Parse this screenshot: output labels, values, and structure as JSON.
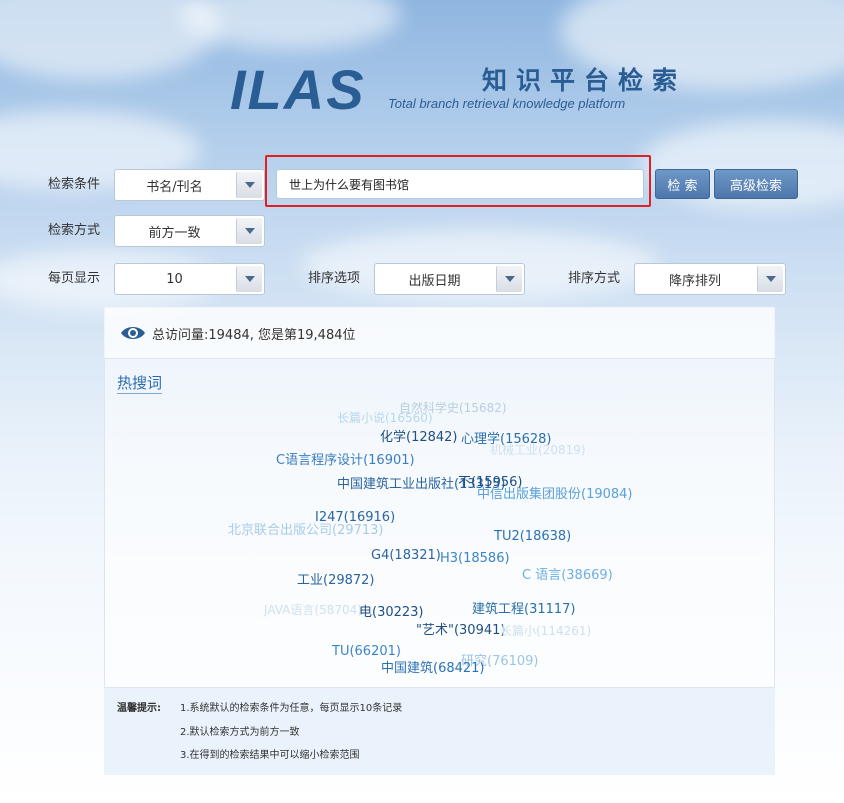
{
  "logo": {
    "brand": "ILAS",
    "title_cn": "知识平台检索",
    "title_en": "Total branch retrieval knowledge platform"
  },
  "search": {
    "condition_label": "检索条件",
    "condition_value": "书名/刊名",
    "query_value": "世上为什么要有图书馆",
    "search_button": "检 索",
    "advanced_button": "高级检索",
    "mode_label": "检索方式",
    "mode_value": "前方一致",
    "perpage_label": "每页显示",
    "perpage_value": "10",
    "sort_label": "排序选项",
    "sort_value": "出版日期",
    "order_label": "排序方式",
    "order_value": "降序排列"
  },
  "stats": {
    "visits_text": "总访问量:19484, 您是第19,484位"
  },
  "hot": {
    "title": "热搜词",
    "words": [
      {
        "text": "自然科学史(15682)",
        "color": "#b9cde3"
      },
      {
        "text": "长篇小说(16560)",
        "color": "#b5d8ec"
      },
      {
        "text": "化学(12842)",
        "color": "#1f4f82"
      },
      {
        "text": "心理学(15628)",
        "color": "#2a6fa8"
      },
      {
        "text": "机械工业(20819)",
        "color": "#cfe1ee"
      },
      {
        "text": "C语言程序设计(16901)",
        "color": "#3b7dc0"
      },
      {
        "text": "中国建筑工业出版社(13315)",
        "color": "#2c64a0"
      },
      {
        "text": "不(15956)",
        "color": "#1f4f82"
      },
      {
        "text": "中信出版集团股份(19084)",
        "color": "#5aa0d8"
      },
      {
        "text": "I247(16916)",
        "color": "#2c64a0"
      },
      {
        "text": "北京联合出版公司(29713)",
        "color": "#a9cbe6"
      },
      {
        "text": "TU2(18638)",
        "color": "#2a72b8"
      },
      {
        "text": "G4(18321)",
        "color": "#2c64a0"
      },
      {
        "text": "H3(18586)",
        "color": "#3a86c8"
      },
      {
        "text": "C 语言(38669)",
        "color": "#6fb0e0"
      },
      {
        "text": "工业(29872)",
        "color": "#2c64a0"
      },
      {
        "text": "JAVA语言(58704)",
        "color": "#cfe1ee"
      },
      {
        "text": "电(30223)",
        "color": "#1f4f82"
      },
      {
        "text": "建筑工程(31117)",
        "color": "#2a6fa8"
      },
      {
        "text": "\"艺术\"(30941)",
        "color": "#1f4f82"
      },
      {
        "text": "长篇小(114261)",
        "color": "#cfe1ee"
      },
      {
        "text": "TU(66201)",
        "color": "#3a86c8"
      },
      {
        "text": "研究(76109)",
        "color": "#9cc4e4"
      },
      {
        "text": "中国建筑(68421)",
        "color": "#2a72b8"
      }
    ]
  },
  "tips": {
    "label": "温馨提示:",
    "lines": [
      "1.系统默认的检索条件为任意，每页显示10条记录",
      "2.默认检索方式为前方一致",
      "3.在得到的检索结果中可以缩小检索范围"
    ]
  },
  "colors": {
    "brand": "#2b5d95",
    "highlight": "#e02020",
    "button": "#4d77ab"
  }
}
